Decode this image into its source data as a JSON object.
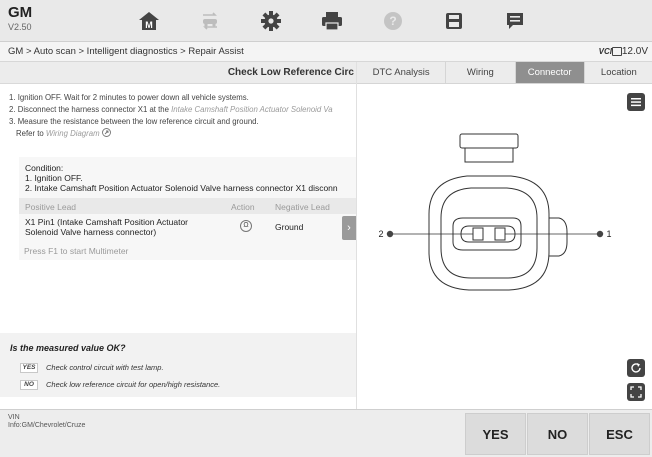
{
  "app": {
    "make": "GM",
    "version": "V2.50"
  },
  "toolbar": {
    "items": [
      {
        "icon": "home-icon"
      },
      {
        "icon": "vehicle-swap-icon"
      },
      {
        "icon": "settings-gear-icon"
      },
      {
        "icon": "printer-icon"
      },
      {
        "icon": "help-icon"
      },
      {
        "icon": "save-icon"
      },
      {
        "icon": "message-icon"
      }
    ]
  },
  "breadcrumb": "GM > Auto scan > Intelligent diagnostics > Repair Assist",
  "status": {
    "vci": "VCI",
    "voltage": "12.0V"
  },
  "left": {
    "title": "Check Low Reference Circ",
    "steps": [
      {
        "num": "1.",
        "text": "Ignition OFF. Wait for 2 minutes to power down all vehicle systems."
      },
      {
        "num": "2.",
        "text": "Disconnect the harness connector X1 at the ",
        "link": "Intake Camshaft Position Actuator Solenoid Va"
      },
      {
        "num": "3.",
        "text": "Measure the resistance between the low reference circuit and ground."
      }
    ],
    "refer_prefix": "Refer to ",
    "refer_link": "Wiring Diagram",
    "condition": {
      "title": "Condition:",
      "line1": "1. Ignition OFF.",
      "line2": "2. Intake Camshaft Position Actuator Solenoid Valve harness connector X1 disconn"
    },
    "table": {
      "headers": [
        "Positive Lead",
        "Action",
        "Negative Lead"
      ],
      "row": {
        "positive": "X1 Pin1 (Intake Camshaft Position Actuator Solenoid Valve harness connector)",
        "action": "Ω",
        "negative": "Ground"
      }
    },
    "press_hint": "Press F1 to start Multimeter",
    "question": {
      "title": "Is the measured value OK?",
      "yes_tag": "YES",
      "yes_text": "Check control circuit with test lamp.",
      "no_tag": "NO",
      "no_text": "Check low reference circuit for open/high resistance."
    }
  },
  "right": {
    "tabs": [
      {
        "label": "DTC Analysis",
        "active": false
      },
      {
        "label": "Wiring",
        "active": false
      },
      {
        "label": "Connector",
        "active": true
      },
      {
        "label": "Location",
        "active": false
      }
    ],
    "pin_left": "2",
    "pin_right": "1"
  },
  "bottom": {
    "vin_label": "VIN",
    "vehicle_info": "Info:GM/Chevrolet/Cruze",
    "yes": "YES",
    "no": "NO",
    "esc": "ESC"
  }
}
